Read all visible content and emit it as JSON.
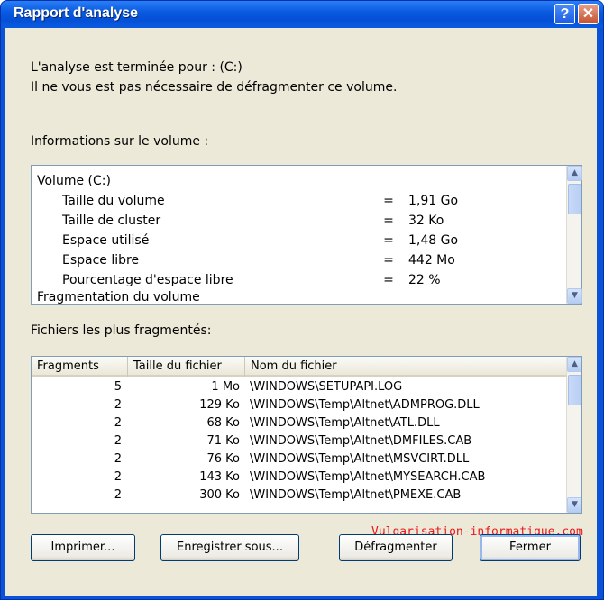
{
  "window": {
    "title": "Rapport d'analyse",
    "help_glyph": "?",
    "close_glyph": "✕"
  },
  "message": {
    "line1": "L'analyse est terminée pour : (C:)",
    "line2": "Il ne vous est pas nécessaire de défragmenter ce volume."
  },
  "volume_section": {
    "label": "Informations sur le volume :",
    "heading": "Volume (C:)",
    "rows": [
      {
        "name": "Taille du volume",
        "eq": "=",
        "value": "1,91 Go"
      },
      {
        "name": "Taille de cluster",
        "eq": "=",
        "value": "32 Ko"
      },
      {
        "name": "Espace utilisé",
        "eq": "=",
        "value": "1,48 Go"
      },
      {
        "name": "Espace libre",
        "eq": "=",
        "value": "442 Mo"
      },
      {
        "name": "Pourcentage d'espace libre",
        "eq": "=",
        "value": "22 %"
      }
    ],
    "next_heading": "Fragmentation du volume"
  },
  "files_section": {
    "label": "Fichiers les plus fragmentés:",
    "columns": [
      "Fragments",
      "Taille du fichier",
      "Nom du fichier"
    ],
    "rows": [
      {
        "fragments": "5",
        "size": "1 Mo",
        "name": "\\WINDOWS\\SETUPAPI.LOG"
      },
      {
        "fragments": "2",
        "size": "129 Ko",
        "name": "\\WINDOWS\\Temp\\Altnet\\ADMPROG.DLL"
      },
      {
        "fragments": "2",
        "size": "68 Ko",
        "name": "\\WINDOWS\\Temp\\Altnet\\ATL.DLL"
      },
      {
        "fragments": "2",
        "size": "71 Ko",
        "name": "\\WINDOWS\\Temp\\Altnet\\DMFILES.CAB"
      },
      {
        "fragments": "2",
        "size": "76 Ko",
        "name": "\\WINDOWS\\Temp\\Altnet\\MSVCIRT.DLL"
      },
      {
        "fragments": "2",
        "size": "143 Ko",
        "name": "\\WINDOWS\\Temp\\Altnet\\MYSEARCH.CAB"
      },
      {
        "fragments": "2",
        "size": "300 Ko",
        "name": "\\WINDOWS\\Temp\\Altnet\\PMEXE.CAB"
      }
    ]
  },
  "watermark": "Vulgarisation-informatique.com",
  "buttons": {
    "print": "Imprimer...",
    "save_as": "Enregistrer sous...",
    "defrag": "Défragmenter",
    "close": "Fermer"
  },
  "colors": {
    "titlebar": "#0a5be0",
    "dialog_bg": "#ece9d8",
    "watermark": "#e8191c"
  }
}
